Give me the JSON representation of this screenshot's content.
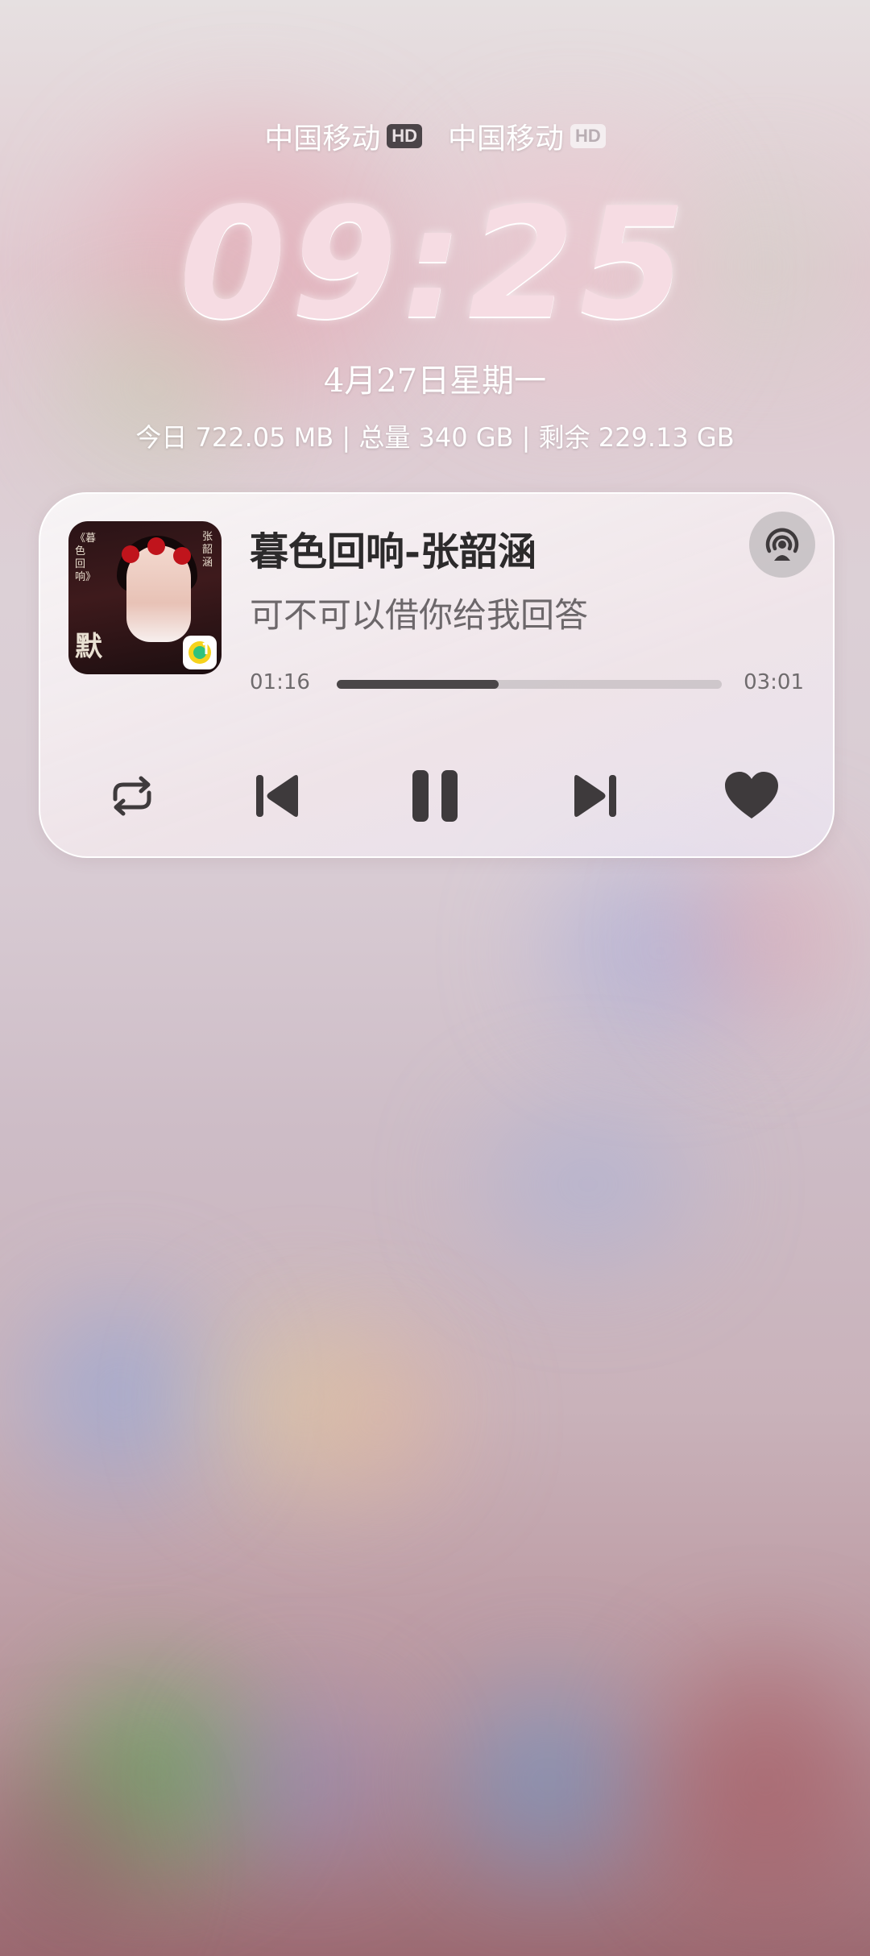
{
  "status": {
    "carriers": [
      {
        "name": "中国移动",
        "badge": "HD"
      },
      {
        "name": "中国移动",
        "badge": "HD"
      }
    ]
  },
  "lockscreen": {
    "time": "09:25",
    "date": "4月27日星期一",
    "storage": "今日 722.05 MB | 总量 340 GB | 剩余 229.13 GB"
  },
  "music": {
    "song_title": "暮色回响-张韶涵",
    "lyric": "可不可以借你给我回答",
    "elapsed": "01:16",
    "total": "03:01",
    "progress_fraction": 0.42,
    "album": {
      "title_art": "默",
      "side_text": "《暮色回响》",
      "artist_text": "张韶涵"
    },
    "icons": {
      "cast": "cast-audio-icon",
      "repeat": "repeat-icon",
      "previous": "skip-previous-icon",
      "play_pause": "pause-icon",
      "next": "skip-next-icon",
      "like": "heart-icon",
      "app": "qq-music-icon"
    }
  },
  "colors": {
    "control": "#3e3a3c",
    "accent_pink": "#f6dce3"
  }
}
